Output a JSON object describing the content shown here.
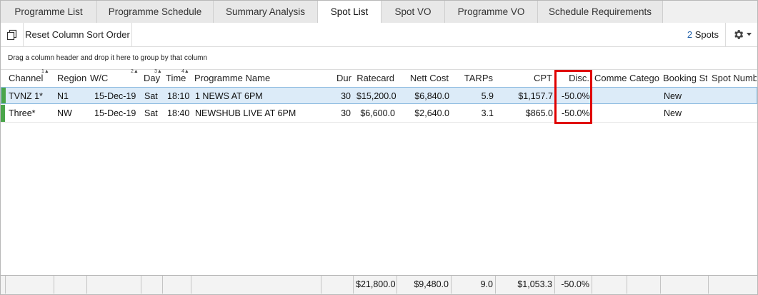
{
  "tabs": [
    {
      "label": "Programme List",
      "active": false
    },
    {
      "label": "Programme Schedule",
      "active": false
    },
    {
      "label": "Summary Analysis",
      "active": false
    },
    {
      "label": "Spot List",
      "active": true
    },
    {
      "label": "Spot VO",
      "active": false
    },
    {
      "label": "Programme VO",
      "active": false
    },
    {
      "label": "Schedule Requirements",
      "active": false
    }
  ],
  "toolbar": {
    "copy_icon": "copy-icon",
    "reset_label": "Reset Column Sort Order",
    "spots_count": "2",
    "spots_label": "Spots",
    "gear_icon": "gear-icon"
  },
  "group_panel": {
    "hint": "Drag a column header and drop it here to group by that column"
  },
  "columns": {
    "channel": {
      "label": "Channel",
      "sort": "1"
    },
    "region": {
      "label": "Region"
    },
    "wc": {
      "label": "W/C",
      "sort": "2"
    },
    "day": {
      "label": "Day",
      "sort": "3"
    },
    "time": {
      "label": "Time",
      "sort": "4"
    },
    "programme": {
      "label": "Programme Name"
    },
    "dur": {
      "label": "Dur"
    },
    "ratecard": {
      "label": "Ratecard"
    },
    "nett": {
      "label": "Nett Cost"
    },
    "tarps": {
      "label": "TARPs"
    },
    "cpt": {
      "label": "CPT"
    },
    "disc": {
      "label": "Disc."
    },
    "comment": {
      "label": "Comme"
    },
    "category": {
      "label": "Catego"
    },
    "booking": {
      "label": "Booking St"
    },
    "spotnum": {
      "label": "Spot Numb"
    }
  },
  "rows": [
    {
      "channel": "TVNZ 1*",
      "region": "N1",
      "wc": "15-Dec-19",
      "day": "Sat",
      "time": "18:10",
      "programme": "1 NEWS AT 6PM",
      "dur": "30",
      "ratecard": "$15,200.0",
      "nett": "$6,840.0",
      "tarps": "5.9",
      "cpt": "$1,157.7",
      "disc": "-50.0%",
      "comment": "",
      "category": "",
      "booking": "New",
      "spotnum": ""
    },
    {
      "channel": "Three*",
      "region": "NW",
      "wc": "15-Dec-19",
      "day": "Sat",
      "time": "18:40",
      "programme": "NEWSHUB LIVE AT 6PM",
      "dur": "30",
      "ratecard": "$6,600.0",
      "nett": "$2,640.0",
      "tarps": "3.1",
      "cpt": "$865.0",
      "disc": "-50.0%",
      "comment": "",
      "category": "",
      "booking": "New",
      "spotnum": ""
    }
  ],
  "totals": {
    "ratecard": "$21,800.0",
    "nett": "$9,480.0",
    "tarps": "9.0",
    "cpt": "$1,053.3",
    "disc": "-50.0%"
  },
  "colors": {
    "accent": "#1f5fa8",
    "row_indicator": "#4aa54a",
    "selected_row": "#dcebf8",
    "highlight_box": "#e00000"
  }
}
